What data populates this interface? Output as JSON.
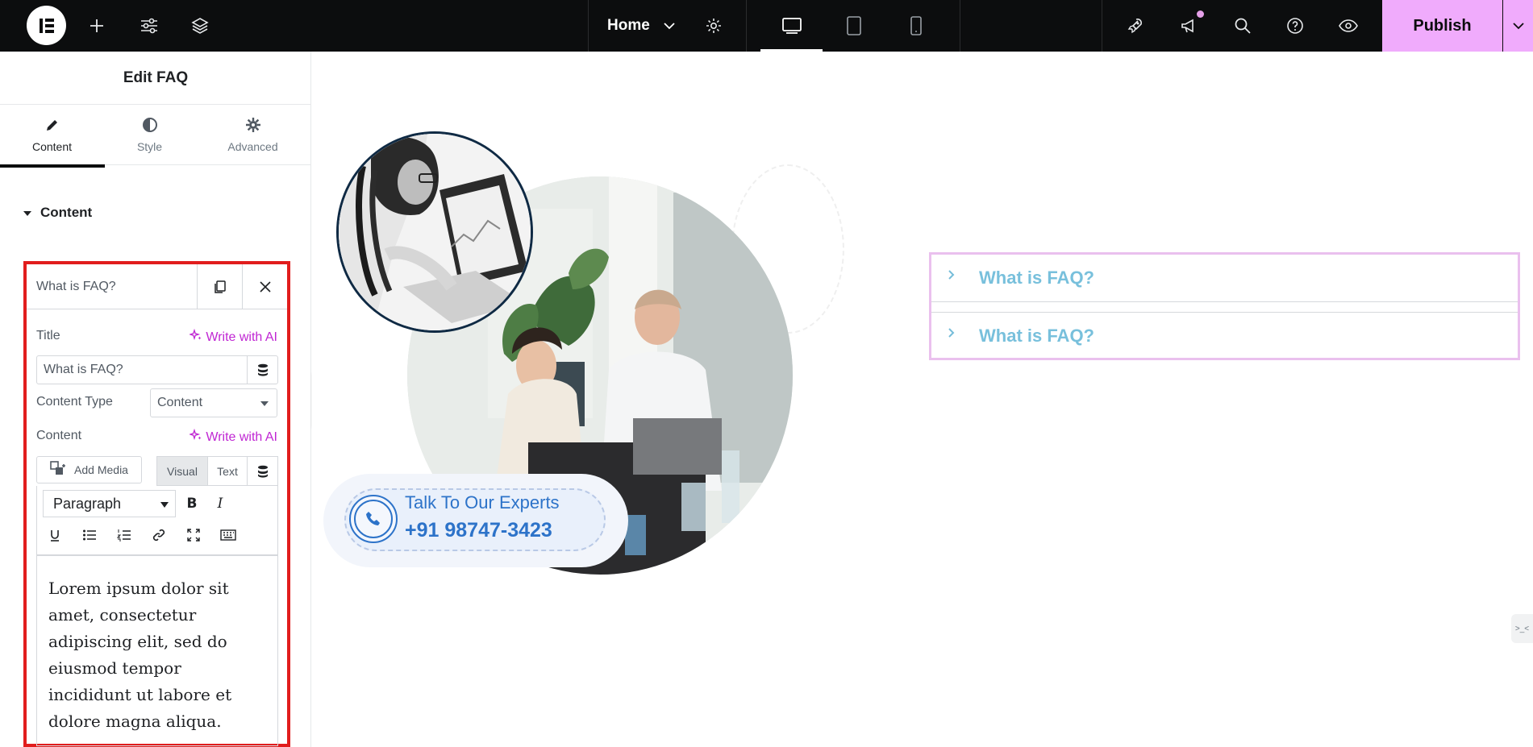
{
  "topbar": {
    "page_name": "Home",
    "publish_label": "Publish",
    "colors": {
      "background": "#0c0d0e",
      "publish": "#f0abfc"
    }
  },
  "panel": {
    "title": "Edit FAQ",
    "tabs": [
      {
        "label": "Content",
        "icon": "pencil-icon"
      },
      {
        "label": "Style",
        "icon": "half-circle-icon"
      },
      {
        "label": "Advanced",
        "icon": "gear-icon"
      }
    ],
    "section_label": "Content",
    "item": {
      "header_title": "What is FAQ?",
      "title_label": "Title",
      "write_ai": "Write with AI",
      "title_value": "What is FAQ?",
      "content_type_label": "Content Type",
      "content_type_value": "Content",
      "content_label": "Content",
      "add_media": "Add Media",
      "editor_tab_visual": "Visual",
      "editor_tab_text": "Text",
      "format_select": "Paragraph",
      "body_text": "Lorem ipsum dolor sit amet, consectetur adipiscing elit, sed do eiusmod tempor incididunt ut labore et dolore magna aliqua."
    }
  },
  "canvas": {
    "contact": {
      "label": "Talk To Our Experts",
      "number": "+91 98747-3423"
    },
    "faq": [
      {
        "question": "What is FAQ?"
      },
      {
        "question": "What is FAQ?"
      }
    ],
    "side_tab": ">_<",
    "colors": {
      "faq_text": "#78c0dc",
      "contact": "#2d73c9",
      "selection": "#eac0ee",
      "highlight": "#e11d1d"
    }
  }
}
